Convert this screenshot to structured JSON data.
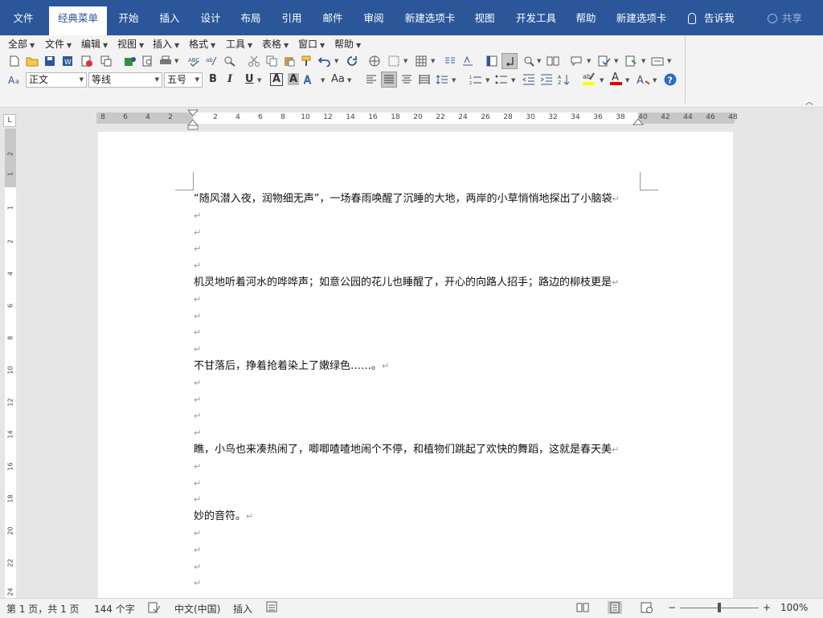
{
  "tabs": [
    {
      "label": "文件"
    },
    {
      "label": "经典菜单"
    },
    {
      "label": "开始"
    },
    {
      "label": "插入"
    },
    {
      "label": "设计"
    },
    {
      "label": "布局"
    },
    {
      "label": "引用"
    },
    {
      "label": "邮件"
    },
    {
      "label": "审阅"
    },
    {
      "label": "新建选项卡"
    },
    {
      "label": "视图"
    },
    {
      "label": "开发工具"
    },
    {
      "label": "帮助"
    },
    {
      "label": "新建选项卡"
    }
  ],
  "tell_me": "告诉我",
  "share": "共享",
  "menu": [
    {
      "label": "全部"
    },
    {
      "label": "文件"
    },
    {
      "label": "编辑"
    },
    {
      "label": "视图"
    },
    {
      "label": "插入"
    },
    {
      "label": "格式"
    },
    {
      "label": "工具"
    },
    {
      "label": "表格"
    },
    {
      "label": "窗口"
    },
    {
      "label": "帮助"
    }
  ],
  "format": {
    "style": "正文",
    "font": "等线",
    "size": "五号",
    "bold": "B",
    "italic": "I",
    "underline": "U",
    "char_border": "A",
    "char_shading": "A",
    "change_case": "Aa"
  },
  "ruler": {
    "h_numbers": [
      "8",
      "6",
      "4",
      "2",
      "2",
      "4",
      "6",
      "8",
      "10",
      "12",
      "14",
      "16",
      "18",
      "20",
      "22",
      "24",
      "26",
      "28",
      "30",
      "32",
      "34",
      "36",
      "38",
      "40",
      "42",
      "44",
      "46",
      "48"
    ],
    "v_numbers": [
      "2",
      "1",
      "1",
      "2",
      "4",
      "6",
      "8",
      "10",
      "12",
      "14",
      "16",
      "18",
      "20",
      "22",
      "24"
    ]
  },
  "document": {
    "lines": [
      "“随风潜入夜，润物细无声”，一场春雨唤醒了沉睡的大地，两岸的小草悄悄地探出了小脑袋",
      "",
      "",
      "",
      "",
      "机灵地听着河水的哗哗声；如意公园的花儿也睡醒了，开心的向路人招手；路边的柳枝更是",
      "",
      "",
      "",
      "",
      "不甘落后，挣着抢着染上了嫩绿色……。",
      "",
      "",
      "",
      "",
      "瞧，小鸟也来凑热闹了，唧唧喳喳地闹个不停，和植物们跳起了欢快的舞蹈，这就是春天美",
      "",
      "",
      "",
      "妙的音符。",
      "",
      "",
      "",
      ""
    ],
    "paragraph_mark": "↵"
  },
  "status": {
    "page": "第 1 页，共 1 页",
    "words": "144 个字",
    "language": "中文(中国)",
    "mode": "插入",
    "zoom_minus": "−",
    "zoom_plus": "+",
    "zoom": "100%"
  },
  "colors": {
    "brand": "#2b579a",
    "highlight": "#ffff00",
    "font_color": "#e00000",
    "help": "#2b6cc4"
  }
}
